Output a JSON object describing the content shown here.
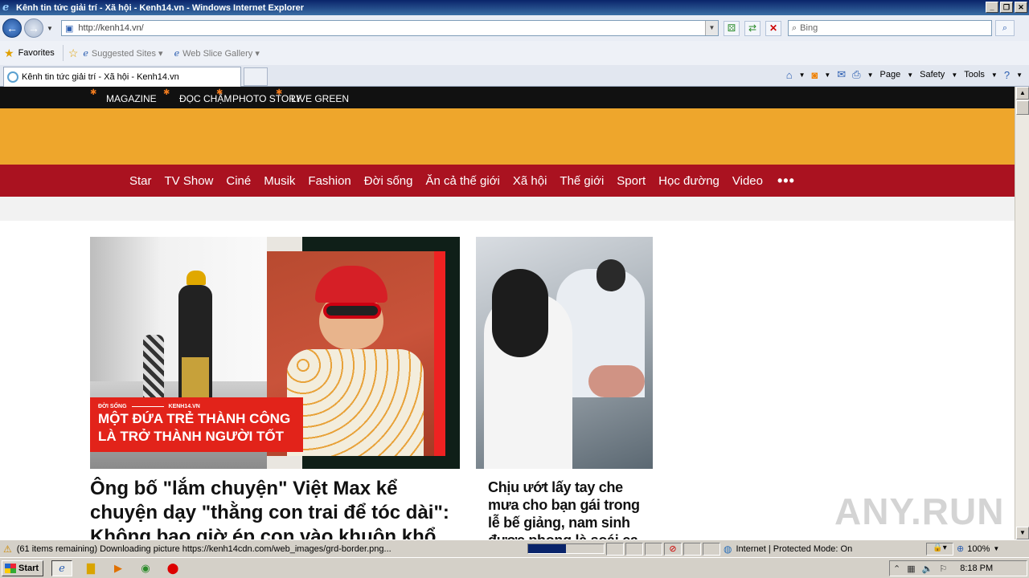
{
  "window": {
    "title": "Kênh tin tức giải trí - Xã hội - Kenh14.vn - Windows Internet Explorer",
    "controls": [
      "_",
      "❐",
      "✕"
    ]
  },
  "address_bar": {
    "url": "http://kenh14.vn/",
    "search_placeholder": "Bing"
  },
  "favorites_bar": {
    "favorites_label": "Favorites",
    "links": [
      "Suggested Sites ▾",
      "Web Slice Gallery ▾"
    ]
  },
  "tab": {
    "title": "Kênh tin tức giải trí - Xã hội - Kenh14.vn"
  },
  "command_bar": {
    "page": "Page",
    "safety": "Safety",
    "tools": "Tools"
  },
  "site": {
    "top_nav": [
      "MAGAZINE",
      "ĐỌC CHẬM",
      "PHOTO STORY",
      "LIVE GREEN"
    ],
    "main_nav": [
      "Star",
      "TV Show",
      "Ciné",
      "Musik",
      "Fashion",
      "Đời sống",
      "Ăn cả thế giới",
      "Xã hội",
      "Thế giới",
      "Sport",
      "Học đường",
      "Video"
    ],
    "more": "•••",
    "featured": {
      "category": "ĐỜI SỐNG",
      "brand": "KENH14.VN",
      "overlay_line1": "MỘT ĐỨA TRẺ THÀNH CÔNG",
      "overlay_line2": "LÀ TRỞ THÀNH NGƯỜI TỐT",
      "title": "Ông bố \"lắm chuyện\" Việt Max kể chuyện dạy \"thằng con trai để tóc dài\": Không bao giờ ép con vào khuôn khổ"
    },
    "side": {
      "title": "Chịu ướt lấy tay che mưa cho bạn gái trong lễ bế giảng, nam sinh được phong là soái ca"
    }
  },
  "watermark": "ANY.RUN",
  "status_bar": {
    "message": "(61 items remaining) Downloading picture https://kenh14cdn.com/web_images/grd-border.png...",
    "progress": 0.5,
    "zone": "Internet | Protected Mode: On",
    "zoom": "100%"
  },
  "taskbar": {
    "start": "Start",
    "clock": "8:18 PM"
  }
}
